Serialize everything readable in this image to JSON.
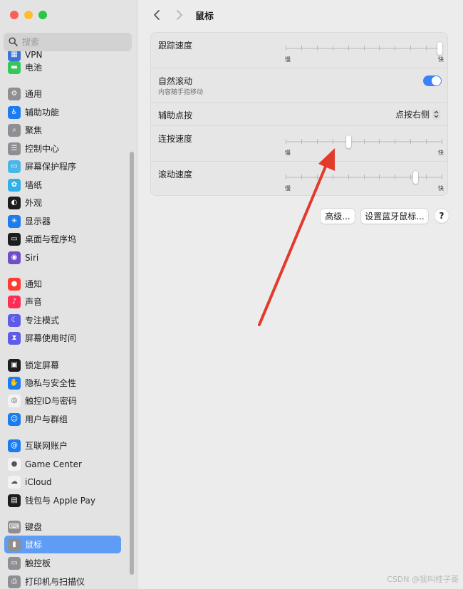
{
  "window": {
    "traffic_lights": {
      "close": "#fe5f57",
      "minimize": "#febc2e",
      "maximize": "#28c840"
    }
  },
  "sidebar": {
    "search_placeholder": "搜索",
    "items": [
      {
        "label": "VPN",
        "icon": "vpn-icon",
        "color": "#3b73d9",
        "glyph": "▦"
      },
      {
        "label": "电池",
        "icon": "battery-icon",
        "color": "#34c759",
        "glyph": "▬"
      },
      {
        "label": "通用",
        "icon": "gear-icon",
        "color": "#8e8e93",
        "glyph": "⚙"
      },
      {
        "label": "辅助功能",
        "icon": "accessibility-icon",
        "color": "#1b7cf0",
        "glyph": "♿"
      },
      {
        "label": "聚焦",
        "icon": "spotlight-icon",
        "color": "#8e8e93",
        "glyph": "⌕"
      },
      {
        "label": "控制中心",
        "icon": "control-center-icon",
        "color": "#8e8e93",
        "glyph": "☰"
      },
      {
        "label": "屏幕保护程序",
        "icon": "screensaver-icon",
        "color": "#4bb6e8",
        "glyph": "▭"
      },
      {
        "label": "墙纸",
        "icon": "wallpaper-icon",
        "color": "#30b0e8",
        "glyph": "✿"
      },
      {
        "label": "外观",
        "icon": "appearance-icon",
        "color": "#1d1d1f",
        "glyph": "◐"
      },
      {
        "label": "显示器",
        "icon": "display-icon",
        "color": "#1b7cf0",
        "glyph": "☀"
      },
      {
        "label": "桌面与程序坞",
        "icon": "dock-icon",
        "color": "#1d1d1f",
        "glyph": "▭"
      },
      {
        "label": "Siri",
        "icon": "siri-icon",
        "color": "#6e4fc6",
        "glyph": "◉"
      },
      {
        "label": "通知",
        "icon": "notifications-icon",
        "color": "#ff3b30",
        "glyph": "●"
      },
      {
        "label": "声音",
        "icon": "sound-icon",
        "color": "#ff2d55",
        "glyph": "♪"
      },
      {
        "label": "专注模式",
        "icon": "focus-icon",
        "color": "#5e5ce6",
        "glyph": "☾"
      },
      {
        "label": "屏幕使用时间",
        "icon": "screen-time-icon",
        "color": "#5e5ce6",
        "glyph": "⧗"
      },
      {
        "label": "锁定屏幕",
        "icon": "lock-icon",
        "color": "#1d1d1f",
        "glyph": "▣"
      },
      {
        "label": "隐私与安全性",
        "icon": "privacy-icon",
        "color": "#1b7cf0",
        "glyph": "✋"
      },
      {
        "label": "触控ID与密码",
        "icon": "touch-id-icon",
        "color": "#f2f2f2",
        "glyph": "◎"
      },
      {
        "label": "用户与群组",
        "icon": "users-icon",
        "color": "#1b7cf0",
        "glyph": "☺"
      },
      {
        "label": "互联网账户",
        "icon": "internet-accounts-icon",
        "color": "#1b7cf0",
        "glyph": "@"
      },
      {
        "label": "Game Center",
        "icon": "game-center-icon",
        "color": "#f2f2f2",
        "glyph": "●"
      },
      {
        "label": "iCloud",
        "icon": "icloud-icon",
        "color": "#f2f2f2",
        "glyph": "☁"
      },
      {
        "label": "钱包与 Apple Pay",
        "icon": "wallet-icon",
        "color": "#1d1d1f",
        "glyph": "▤"
      },
      {
        "label": "键盘",
        "icon": "keyboard-icon",
        "color": "#8e8e93",
        "glyph": "⌨"
      },
      {
        "label": "鼠标",
        "icon": "mouse-icon",
        "color": "#8e8e93",
        "glyph": "▮",
        "selected": true
      },
      {
        "label": "触控板",
        "icon": "trackpad-icon",
        "color": "#8e8e93",
        "glyph": "▭"
      },
      {
        "label": "打印机与扫描仪",
        "icon": "printer-icon",
        "color": "#8e8e93",
        "glyph": "⎙"
      }
    ]
  },
  "main": {
    "title": "鼠标",
    "rows": {
      "tracking": {
        "label": "跟踪速度",
        "min": "慢",
        "max": "快",
        "value": 1.0
      },
      "natural_scroll": {
        "label": "自然滚动",
        "sublabel": "内容随手指移动",
        "enabled": true
      },
      "secondary_click": {
        "label": "辅助点按",
        "value": "点按右侧"
      },
      "double_click": {
        "label": "连按速度",
        "min": "慢",
        "max": "快",
        "value": 0.4
      },
      "scroll_speed": {
        "label": "滚动速度",
        "min": "慢",
        "max": "快",
        "value": 0.84
      }
    },
    "buttons": {
      "advanced": "高级...",
      "bluetooth": "设置蓝牙鼠标...",
      "help": "?"
    }
  },
  "annotation": {
    "color": "#e23a2b"
  },
  "watermark": "CSDN @我叫桂子哥"
}
